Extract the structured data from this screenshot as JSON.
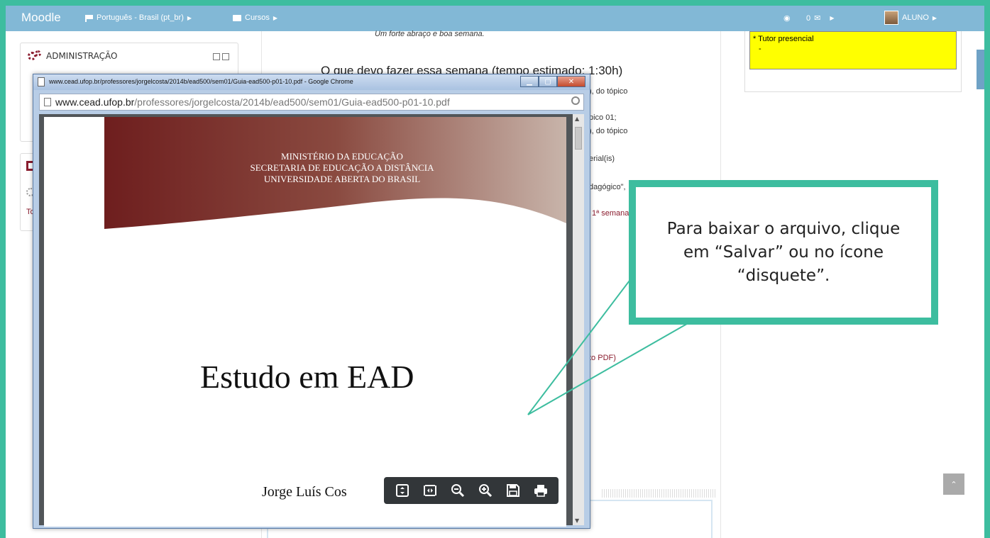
{
  "navbar": {
    "brand": "Moodle",
    "language": "Português - Brasil (pt_br)",
    "courses": "Cursos",
    "messages": "0",
    "user": "ALUNO"
  },
  "admin_block": {
    "title": "ADMINISTRAÇÃO"
  },
  "block2": {
    "fragment": "To"
  },
  "center": {
    "italic_top": "Um forte abraço e boa semana.",
    "week_title": "O que devo fazer essa semana (tempo estimado: 1:30h)",
    "fragments": [
      "), do tópico",
      "pico 01;",
      "), do tópico",
      "erial(is)",
      "dagógico\",",
      "1ª semana",
      "to PDF)"
    ]
  },
  "right_block": {
    "tutor_label": "* Tutor presencial",
    "tutor_value": "-"
  },
  "popup": {
    "title": "www.cead.ufop.br/professores/jorgelcosta/2014b/ead500/sem01/Guia-ead500-p01-10.pdf - Google Chrome",
    "url_host": "www.cead.ufop.br",
    "url_path": "/professores/jorgelcosta/2014b/ead500/sem01/Guia-ead500-p01-10.pdf",
    "pdf": {
      "banner_line1": "MINISTÉRIO DA EDUCAÇÃO",
      "banner_line2": "SECRETARIA DE EDUCAÇÃO A DISTÂNCIA",
      "banner_line3": "UNIVERSIDADE ABERTA DO BRASIL",
      "title": "Estudo em EAD",
      "author": "Jorge Luís Cos"
    },
    "toolbar_icons": [
      "fit-page-icon",
      "fit-width-icon",
      "zoom-out-icon",
      "zoom-in-icon",
      "save-disk-icon",
      "print-icon"
    ]
  },
  "callout": {
    "text": "Para baixar o arquivo, clique em “Salvar” ou no ícone “disquete”.",
    "border_color": "#3dbd9f"
  },
  "colors": {
    "navbar": "#82b8d6",
    "accent": "#8a1c2e",
    "highlight": "#ffff00"
  }
}
